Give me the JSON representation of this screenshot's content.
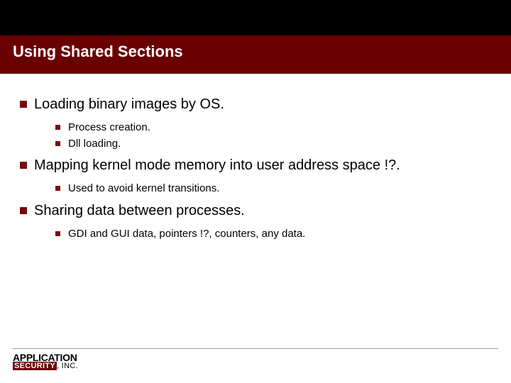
{
  "title": "Using Shared Sections",
  "bullets": [
    {
      "text": "Loading binary images by OS.",
      "sub": [
        "Process creation.",
        "Dll loading."
      ]
    },
    {
      "text": "Mapping kernel mode memory into user address space !?.",
      "sub": [
        "Used to avoid kernel transitions."
      ]
    },
    {
      "text": "Sharing data between processes.",
      "sub": [
        "GDI and GUI data, pointers !?, counters, any data."
      ]
    }
  ],
  "logo": {
    "top": "APPLICATION",
    "sec": "SECURITY",
    "inc": ", INC."
  }
}
